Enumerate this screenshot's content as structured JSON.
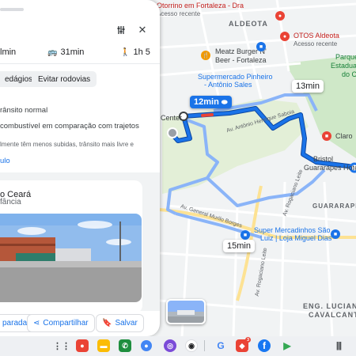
{
  "map": {
    "labels": {
      "place_top1": "Otorrino em Fortaleza - Dra",
      "place_top2": "Acesso recente",
      "aldeota": "ALDEOTA",
      "meatz1": "Meatz Burger N'",
      "meatz2": "Beer - Fortaleza",
      "super1": "Supermercado Pinheiro",
      "super2": "- Antônio Sales",
      "otos1": "OTOS Aldeota",
      "otos2": "Acesso recente",
      "parque1": "Parque",
      "parque2": "Estadual",
      "parque3": "do Coco",
      "center": "Center",
      "avenida1": "Av. Antônio Henrique Saboia",
      "claro": "Claro",
      "bristol1": "Bristol",
      "bristol2": "Guararapes Hotel",
      "guararapes": "GUARARAPES",
      "lane": "Av. Rogaciano Leite",
      "avgm": "Av. General Murilo Borges",
      "super3": "Super Mercadinhos São",
      "super4": "Luiz | Loja Miguel Dias",
      "rogaciano2": "Av. Rogaciano Leite",
      "eng1": "ENG. LUCIANO",
      "eng2": "CAVALCANTE"
    },
    "route_times": {
      "selected": "12min",
      "alt1": "13min",
      "alt2": "15min"
    }
  },
  "panel": {
    "modes": {
      "drive": "lmin",
      "transit": "31min",
      "walk": "1h 5"
    },
    "chips": {
      "tolls": "edágios",
      "highways": "Evitar rodovias"
    },
    "lines": {
      "traffic": "rânsito normal",
      "fuel": "combustível em comparação com trajetos",
      "note": "lmente têm menos subidas, trânsito mais livre e",
      "link": "ulo"
    },
    "place": {
      "title": "o Ceará",
      "subtitle": "fância"
    },
    "actions": {
      "stops": "paradas",
      "share": "Compartilhar",
      "save": "Salvar"
    }
  },
  "taskbar": {
    "badge": "3"
  },
  "colors": {
    "route_blue": "#1a73e8",
    "route_dark": "#0d47a1",
    "alt_route": "#8ab4f8",
    "park_green": "#cfe8c8"
  }
}
